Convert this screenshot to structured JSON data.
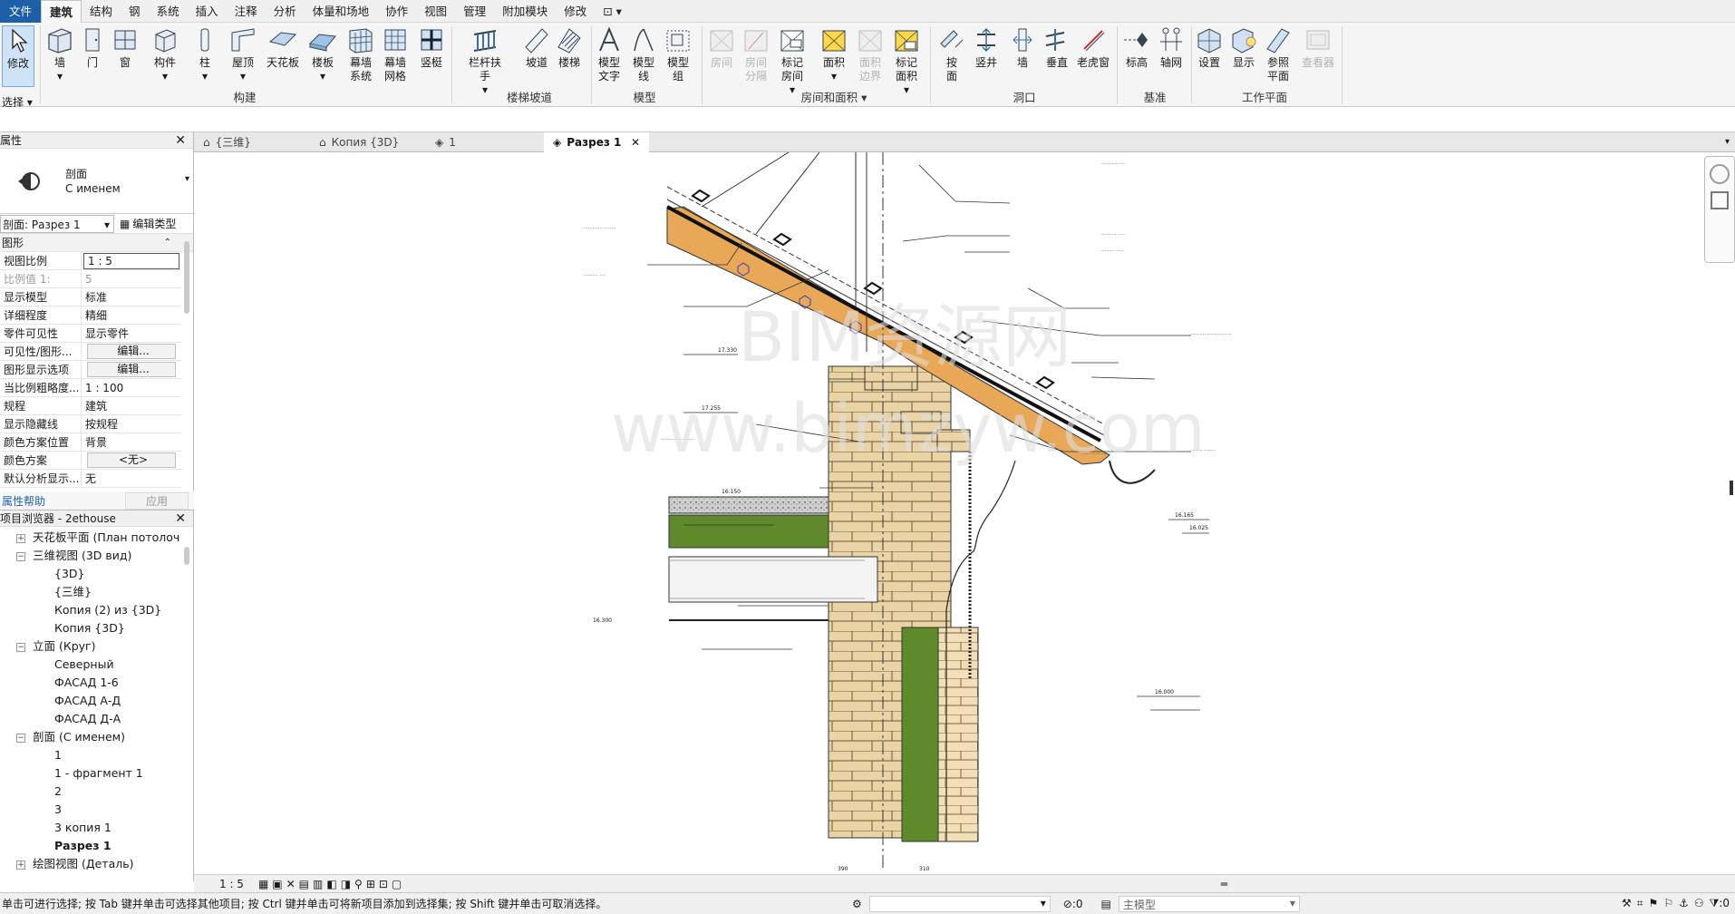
{
  "menubar": {
    "tabs": [
      "文件",
      "建筑",
      "结构",
      "钢",
      "系统",
      "插入",
      "注释",
      "分析",
      "体量和场地",
      "协作",
      "视图",
      "管理",
      "附加模块",
      "修改"
    ],
    "active": "建筑"
  },
  "ribbon": {
    "modify": "修改",
    "select": "选择",
    "build": {
      "items": [
        "墙",
        "门",
        "窗",
        "构件",
        "柱",
        "屋顶",
        "天花板",
        "楼板",
        "幕墙\n系统",
        "幕墙\n网格",
        "竖梃"
      ],
      "label": "构建"
    },
    "stairs": {
      "items": [
        "栏杆扶手",
        "坡道",
        "楼梯"
      ],
      "label": "楼梯坡道"
    },
    "model": {
      "items": [
        "模型\n文字",
        "模型\n线",
        "模型\n组"
      ],
      "label": "模型"
    },
    "room": {
      "items": [
        "房间",
        "房间\n分隔",
        "标记\n房间",
        "面积",
        "面积\n边界",
        "标记\n面积"
      ],
      "label": "房间和面积"
    },
    "opening": {
      "items": [
        "按\n面",
        "竖井",
        "墙",
        "垂直",
        "老虎窗"
      ],
      "label": "洞口"
    },
    "datum": {
      "items": [
        "标高",
        "轴网"
      ],
      "label": "基准"
    },
    "workplane": {
      "items": [
        "设置",
        "显示",
        "参照\n平面",
        "查看器"
      ],
      "label": "工作平面"
    }
  },
  "properties": {
    "title": "属性",
    "type_family": "剖面",
    "type_name": "С именем",
    "instance": "剖面: Разрез 1",
    "edit_type": "编辑类型",
    "group": "图形",
    "rows": [
      {
        "k": "视图比例",
        "v": "1 : 5"
      },
      {
        "k": "比例值 1:",
        "v": "5"
      },
      {
        "k": "显示模型",
        "v": "标准"
      },
      {
        "k": "详细程度",
        "v": "精细"
      },
      {
        "k": "零件可见性",
        "v": "显示零件"
      },
      {
        "k": "可见性/图形...",
        "v": "编辑..."
      },
      {
        "k": "图形显示选项",
        "v": "编辑..."
      },
      {
        "k": "当比例粗略度...",
        "v": "1 : 100"
      },
      {
        "k": "规程",
        "v": "建筑"
      },
      {
        "k": "显示隐藏线",
        "v": "按规程"
      },
      {
        "k": "颜色方案位置",
        "v": "背景"
      },
      {
        "k": "颜色方案",
        "v": "<无>"
      },
      {
        "k": "默认分析显示...",
        "v": "无"
      }
    ],
    "help": "属性帮助",
    "apply": "应用"
  },
  "browser": {
    "title": "项目浏览器 - 2ethouse",
    "nodes": [
      "天花板平面 (План потолоч",
      "三维视图 (3D вид)",
      "{3D}",
      "{三维}",
      "Копия (2) из {3D}",
      "Копия {3D}",
      "立面 (Круг)",
      "Северный",
      "ФАСАД 1-6",
      "ФАСАД А-Д",
      "ФАСАД Д-А",
      "剖面 (С именем)",
      "1",
      "1 - фрагмент 1",
      "2",
      "3",
      "3 копия 1",
      "Разрез 1",
      "绘图视图 (Деталь)"
    ]
  },
  "viewtabs": [
    "{三维}",
    "Копия {3D}",
    "1",
    "Разрез 1"
  ],
  "drawing": {
    "watermark1": "BIM资源网",
    "watermark2": "www.bimzyw.com",
    "levels": [
      "17.330",
      "17.255",
      "16.150",
      "16.300",
      "16.165",
      "16.025",
      "16.000"
    ],
    "dims": [
      "390",
      "310"
    ]
  },
  "viewbar": {
    "scale": "1 : 5"
  },
  "status": {
    "hint": "单击可进行选择; 按 Tab 键并单击可选择其他项目; 按 Ctrl 键并单击可将新项目添加到选择集; 按 Shift 键并单击可取消选择。",
    "coord": ":0",
    "model": "主模型",
    "filter": ":0"
  }
}
